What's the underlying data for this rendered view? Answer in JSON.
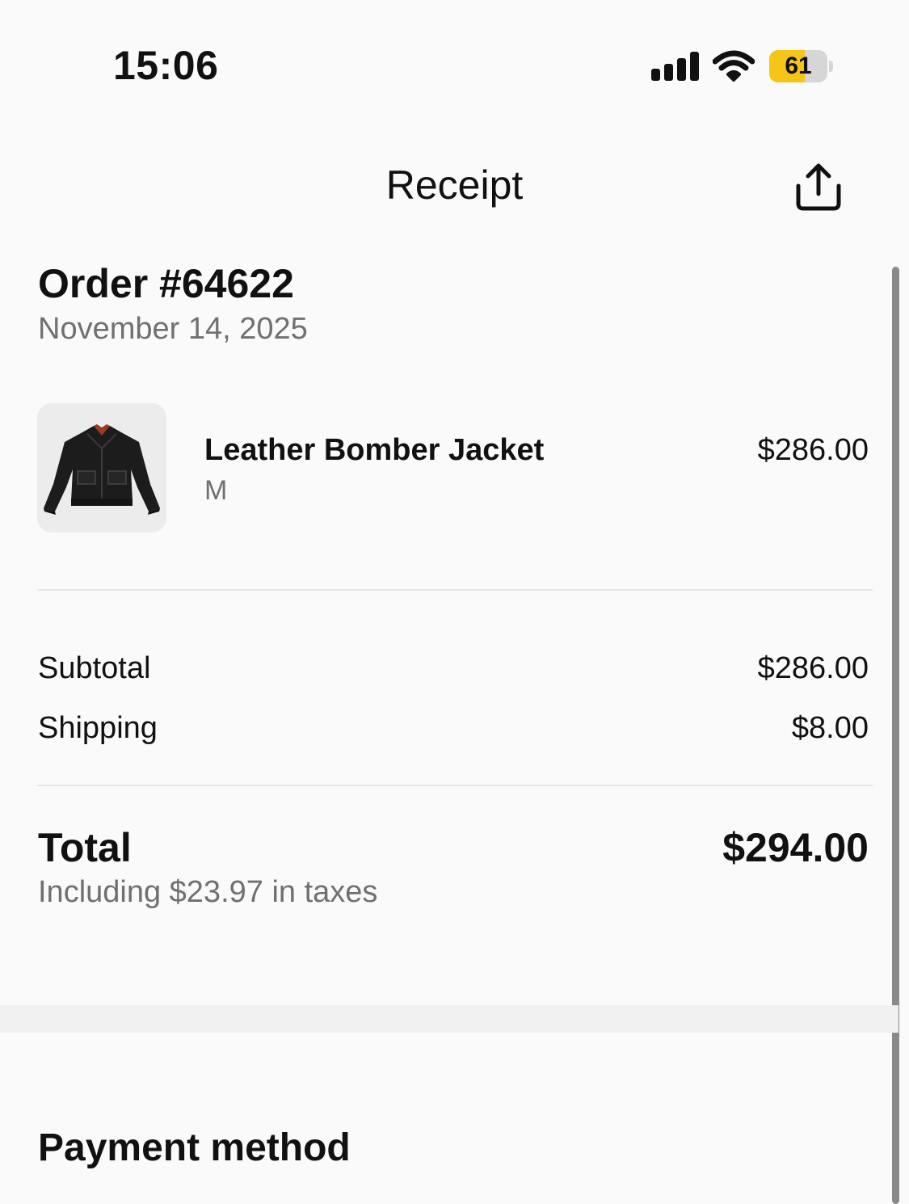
{
  "status_bar": {
    "time": "15:06",
    "battery_level": "61",
    "battery_fraction": 0.61,
    "icons": [
      "signal-icon",
      "wifi-icon",
      "battery-icon"
    ],
    "battery_color": "#f5c518"
  },
  "header": {
    "title": "Receipt",
    "share_icon": "share-icon"
  },
  "order": {
    "title": "Order #64622",
    "date": "November 14, 2025"
  },
  "line_item": {
    "name": "Leather Bomber Jacket",
    "variant": "M",
    "price": "$286.00"
  },
  "summary": {
    "subtotal_label": "Subtotal",
    "subtotal_value": "$286.00",
    "shipping_label": "Shipping",
    "shipping_value": "$8.00"
  },
  "total": {
    "label": "Total",
    "value": "$294.00",
    "taxes_note": "Including $23.97 in taxes"
  },
  "payment": {
    "heading": "Payment method"
  }
}
